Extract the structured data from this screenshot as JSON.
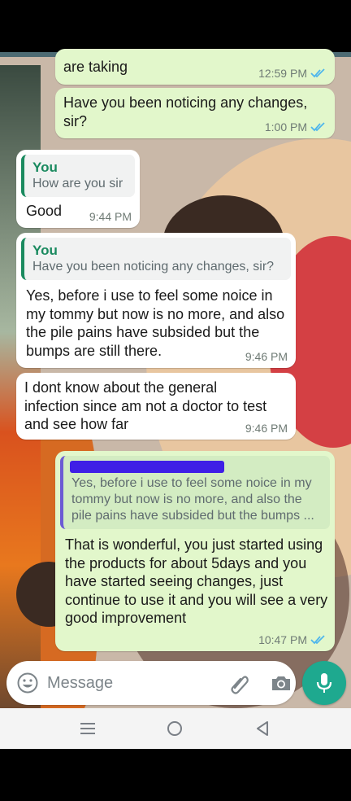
{
  "messages": [
    {
      "type": "out",
      "text": "are taking",
      "time": "12:59 PM"
    },
    {
      "type": "out",
      "text": "Have you been noticing any changes, sir?",
      "time": "1:00 PM"
    },
    {
      "type": "in",
      "quote_name": "You",
      "quote_text": "How are you sir",
      "text": "Good",
      "time": "9:44 PM"
    },
    {
      "type": "in",
      "quote_name": "You",
      "quote_text": "Have you been noticing any changes, sir?",
      "text": "Yes, before i use to feel some noice in my tommy but now is no more, and also the pile pains have subsided but the bumps are still there.",
      "time": "9:46 PM"
    },
    {
      "type": "in",
      "text": "I dont know about the general infection since am not a doctor to test and see how far",
      "time": "9:46 PM"
    },
    {
      "type": "out",
      "quote_text": "Yes, before i use to feel some noice in my tommy but now is no more, and also the pile pains have subsided but the bumps ...",
      "text": "That is wonderful, you just started using the products for about 5days and you have started seeing changes, just continue to use it and you will see a very good improvement",
      "time": "10:47 PM"
    }
  ],
  "composer": {
    "placeholder": "Message"
  },
  "colors": {
    "out_bubble": "#e2f7cb",
    "in_bubble": "#ffffff",
    "read_ticks": "#4fb6ec",
    "mic": "#1ea98f",
    "quote_accent": "#1a8a5f"
  },
  "icons": [
    "emoji-icon",
    "attach-icon",
    "camera-icon",
    "mic-icon",
    "double-check-icon",
    "nav-menu-icon",
    "nav-home-icon",
    "nav-back-icon"
  ]
}
